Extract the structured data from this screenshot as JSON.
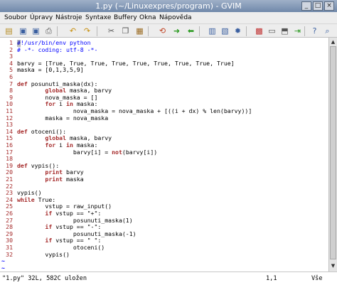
{
  "window": {
    "title": "1.py (~/Linuxexpres/program) - GVIM",
    "buttons": [
      "_",
      "□",
      "×"
    ]
  },
  "menu": [
    "Soubor",
    "Úpravy",
    "Nástroje",
    "Syntaxe",
    "Buffery",
    "Okna",
    "Nápověda"
  ],
  "toolbar": {
    "icons": [
      "open-icon",
      "save-icon",
      "save-all-icon",
      "print-icon",
      "undo-icon",
      "redo-icon",
      "cut-icon",
      "copy-icon",
      "paste-icon",
      "find-replace-icon",
      "find-next-icon",
      "find-prev-icon",
      "load-session-icon",
      "save-session-icon",
      "run-script-icon",
      "make-icon",
      "shell-icon",
      "tag-icon",
      "tag-jump-icon",
      "help-icon",
      "find-help-icon"
    ]
  },
  "editor": {
    "lines": [
      {
        "n": "1",
        "tokens": [
          {
            "t": "#!/usr/bin/env python",
            "c": "cm"
          }
        ]
      },
      {
        "n": "2",
        "tokens": [
          {
            "t": "# -*- coding: utf-8 -*-",
            "c": "cm"
          }
        ]
      },
      {
        "n": "3",
        "tokens": []
      },
      {
        "n": "4",
        "tokens": [
          {
            "t": "barvy = [True, True, True, True, True, True, True, True, True]",
            "c": ""
          }
        ]
      },
      {
        "n": "5",
        "tokens": [
          {
            "t": "maska = [0,1,3,5,9]",
            "c": ""
          }
        ]
      },
      {
        "n": "6",
        "tokens": []
      },
      {
        "n": "7",
        "tokens": [
          {
            "t": "def ",
            "c": "kw"
          },
          {
            "t": "posunuti_maska(dx):",
            "c": ""
          }
        ]
      },
      {
        "n": "8",
        "tokens": [
          {
            "t": "        global ",
            "c": "kw"
          },
          {
            "t": "maska, barvy",
            "c": ""
          }
        ]
      },
      {
        "n": "9",
        "tokens": [
          {
            "t": "        nova_maska = []",
            "c": ""
          }
        ]
      },
      {
        "n": "10",
        "tokens": [
          {
            "t": "        for ",
            "c": "kw"
          },
          {
            "t": "i ",
            "c": ""
          },
          {
            "t": "in ",
            "c": "kw"
          },
          {
            "t": "maska:",
            "c": ""
          }
        ]
      },
      {
        "n": "11",
        "tokens": [
          {
            "t": "                nova_maska = nova_maska + [((i + dx) % len(barvy))]",
            "c": ""
          }
        ]
      },
      {
        "n": "12",
        "tokens": [
          {
            "t": "        maska = nova_maska",
            "c": ""
          }
        ]
      },
      {
        "n": "13",
        "tokens": []
      },
      {
        "n": "14",
        "tokens": [
          {
            "t": "def ",
            "c": "kw"
          },
          {
            "t": "otoceni():",
            "c": ""
          }
        ]
      },
      {
        "n": "15",
        "tokens": [
          {
            "t": "        global ",
            "c": "kw"
          },
          {
            "t": "maska, barvy",
            "c": ""
          }
        ]
      },
      {
        "n": "16",
        "tokens": [
          {
            "t": "        for ",
            "c": "kw"
          },
          {
            "t": "i ",
            "c": ""
          },
          {
            "t": "in ",
            "c": "kw"
          },
          {
            "t": "maska:",
            "c": ""
          }
        ]
      },
      {
        "n": "17",
        "tokens": [
          {
            "t": "                barvy[i] = ",
            "c": ""
          },
          {
            "t": "not",
            "c": "kw"
          },
          {
            "t": "(barvy[i])",
            "c": ""
          }
        ]
      },
      {
        "n": "18",
        "tokens": []
      },
      {
        "n": "19",
        "tokens": [
          {
            "t": "def ",
            "c": "kw"
          },
          {
            "t": "vypis():",
            "c": ""
          }
        ]
      },
      {
        "n": "20",
        "tokens": [
          {
            "t": "        print ",
            "c": "kw"
          },
          {
            "t": "barvy",
            "c": ""
          }
        ]
      },
      {
        "n": "21",
        "tokens": [
          {
            "t": "        print ",
            "c": "kw"
          },
          {
            "t": "maska",
            "c": ""
          }
        ]
      },
      {
        "n": "22",
        "tokens": []
      },
      {
        "n": "23",
        "tokens": [
          {
            "t": "vypis()",
            "c": ""
          }
        ]
      },
      {
        "n": "24",
        "tokens": [
          {
            "t": "while ",
            "c": "kw"
          },
          {
            "t": "True:",
            "c": ""
          }
        ]
      },
      {
        "n": "25",
        "tokens": [
          {
            "t": "        vstup = raw_input()",
            "c": ""
          }
        ]
      },
      {
        "n": "26",
        "tokens": [
          {
            "t": "        if ",
            "c": "kw"
          },
          {
            "t": "vstup == \"+\":",
            "c": ""
          }
        ]
      },
      {
        "n": "27",
        "tokens": [
          {
            "t": "                posunuti_maska(1)",
            "c": ""
          }
        ]
      },
      {
        "n": "28",
        "tokens": [
          {
            "t": "        if ",
            "c": "kw"
          },
          {
            "t": "vstup == \"-\":",
            "c": ""
          }
        ]
      },
      {
        "n": "29",
        "tokens": [
          {
            "t": "                posunuti_maska(-1)",
            "c": ""
          }
        ]
      },
      {
        "n": "30",
        "tokens": [
          {
            "t": "        if ",
            "c": "kw"
          },
          {
            "t": "vstup == \" \":",
            "c": ""
          }
        ]
      },
      {
        "n": "31",
        "tokens": [
          {
            "t": "                otoceni()",
            "c": ""
          }
        ]
      },
      {
        "n": "32",
        "tokens": [
          {
            "t": "        vypis()",
            "c": ""
          }
        ]
      }
    ],
    "tilde_lines": [
      "~",
      "~"
    ]
  },
  "status": {
    "file_info": "\"1.py\" 32L, 582C uložen",
    "position": "1,1",
    "scroll": "Vše"
  },
  "colors": {
    "keyword": "#a52a2a",
    "comment": "#0000ff",
    "line_number": "#a52a2a"
  }
}
